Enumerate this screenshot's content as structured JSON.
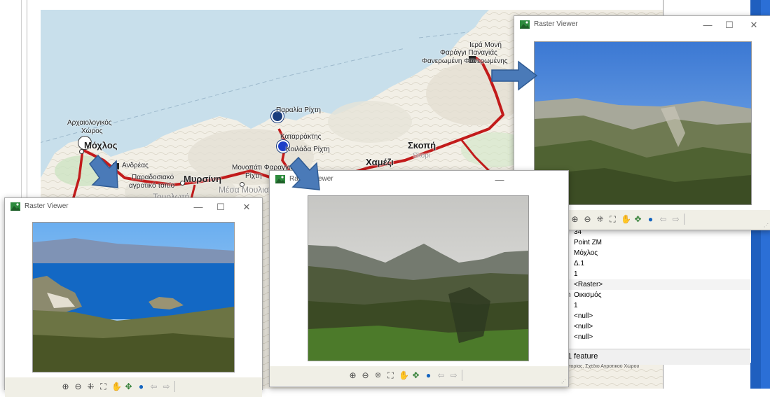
{
  "map": {
    "labels": {
      "moni": "Ιερά Μονή",
      "farangi": "Φαράγγι Παναγιάς",
      "faneromeni": "Φανερωμένη Φανερωμένης",
      "paralia": "Παραλία Ρίχτη",
      "katarraktis": "Καταρράκτης",
      "koilada": "Κοιλάδα Ρίχτη",
      "skopi": "Σκοπή",
      "skopi_latin": "Skopi",
      "xamezi": "Χαμέζι",
      "archaiologikos": "Αρχαιολογικός",
      "xoros": "Χώρος",
      "mochlos": "Μόχλος",
      "androeas": "Ανδρέας",
      "paradosiako": "Παραδοσιακό",
      "agrotiko": "αγροτικό τοπίο",
      "myrsini": "Μυρσίνη",
      "monopati": "Μονοπάτι Φαραγγιού",
      "monopati2": "Ρίχτη",
      "mesa": "Μέσα Μουλιανά",
      "tourloti": "Τουρλωτή"
    }
  },
  "attribute_table": {
    "rows": [
      "34",
      "Point ZM",
      "Μόχλος",
      "Δ.1",
      "1",
      "<Raster>",
      "Οικισμός",
      "1",
      "<null>",
      "<null>",
      "<null>"
    ],
    "row_prefix": "n",
    "footer": "1 feature",
    "footnote": "ιστορίας, Σχέδιο Αγροτικού Χώρου"
  },
  "windows": [
    {
      "title": "Raster Viewer",
      "image": "mountain-forest-photo"
    },
    {
      "title": "Raster Viewer",
      "image": "sea-bay-photo"
    },
    {
      "title": "Raster Viewer",
      "image": "valley-mountains-photo"
    }
  ],
  "window_controls": {
    "minimize": "—",
    "maximize": "☐",
    "close": "✕"
  },
  "toolbar_icons": [
    "zoom-in-icon",
    "zoom-out-icon",
    "fixed-zoom-in-icon",
    "fixed-zoom-out-icon",
    "pan-icon",
    "full-extent-icon",
    "globe-icon",
    "back-icon",
    "forward-icon"
  ],
  "colors": {
    "route": "#c21b1b",
    "arrow": "#4a7ab8",
    "toolbar_bg": "#f0efe6"
  }
}
